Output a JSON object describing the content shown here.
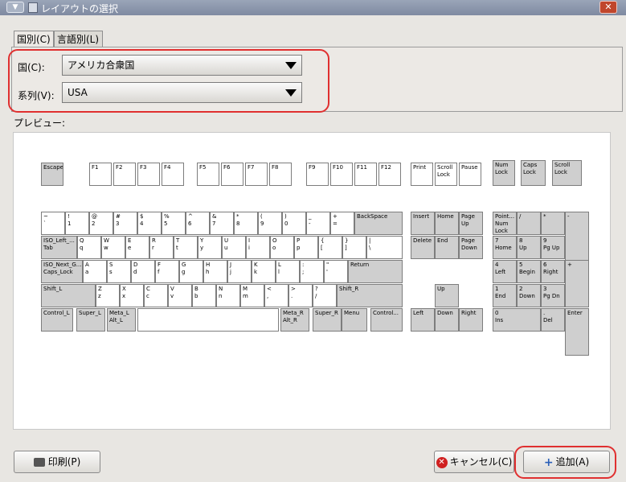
{
  "window": {
    "title": "レイアウトの選択",
    "menu_glyph": "▼",
    "close_glyph": "✕"
  },
  "tabs": [
    {
      "label": "国別(C)"
    },
    {
      "label": "言語別(L)"
    }
  ],
  "fields": {
    "country": {
      "label": "国(C):",
      "value": "アメリカ合衆国"
    },
    "variant": {
      "label": "系列(V):",
      "value": "USA"
    }
  },
  "preview": {
    "label": "プレビュー:"
  },
  "keyboard": {
    "row0": [
      "Escape",
      "F1",
      "F2",
      "F3",
      "F4",
      "F5",
      "F6",
      "F7",
      "F8",
      "F9",
      "F10",
      "F11",
      "F12",
      "Print",
      "Scroll\nLock",
      "Pause",
      "Num\nLock",
      "Caps\nLock",
      "Scroll\nLock"
    ],
    "row1": [
      "~\n`",
      "!\n1",
      "@\n2",
      "#\n3",
      "$\n4",
      "%\n5",
      "^\n6",
      "&\n7",
      "*\n8",
      "(\n9",
      ")\n0",
      "_\n-",
      "+\n=",
      "BackSpace",
      "Insert",
      "Home",
      "Page\nUp",
      "Point...\nNum\nLock",
      "/",
      "*",
      "-"
    ],
    "row2": [
      "ISO_Left_...\nTab",
      "Q\nq",
      "W\nw",
      "E\ne",
      "R\nr",
      "T\nt",
      "Y\ny",
      "U\nu",
      "I\ni",
      "O\no",
      "P\np",
      "{\n[",
      "}\n]",
      "|\n\\",
      "Delete",
      "End",
      "Page\nDown",
      "7\nHome",
      "8\nUp",
      "9\nPg Up",
      "+"
    ],
    "row3": [
      "ISO_Next_G...\nCaps_Lock",
      "A\na",
      "S\ns",
      "D\nd",
      "F\nf",
      "G\ng",
      "H\nh",
      "J\nj",
      "K\nk",
      "L\nl",
      ":\n;",
      "\"\n'",
      "Return",
      "4\nLeft",
      "5\nBegin",
      "6\nRight"
    ],
    "row4": [
      "Shift_L",
      "Z\nz",
      "X\nx",
      "C\nc",
      "V\nv",
      "B\nb",
      "N\nn",
      "M\nm",
      "<\n,",
      ">\n.",
      "?\n/",
      "Shift_R",
      "Up",
      "1\nEnd",
      "2\nDown",
      "3\nPg Dn",
      "Enter"
    ],
    "row5": [
      "Control_L",
      "Super_L",
      "Meta_L\nAlt_L",
      "",
      "Meta_R\nAlt_R",
      "Super_R",
      "Menu",
      "Control...",
      "Left",
      "Down",
      "Right",
      "0\nIns",
      ".\nDel"
    ]
  },
  "buttons": {
    "print": "印刷(P)",
    "cancel": "キャンセル(C)",
    "add": "追加(A)"
  },
  "colors": {
    "highlight": "#e03030",
    "titlebar": "#8a95aa"
  }
}
